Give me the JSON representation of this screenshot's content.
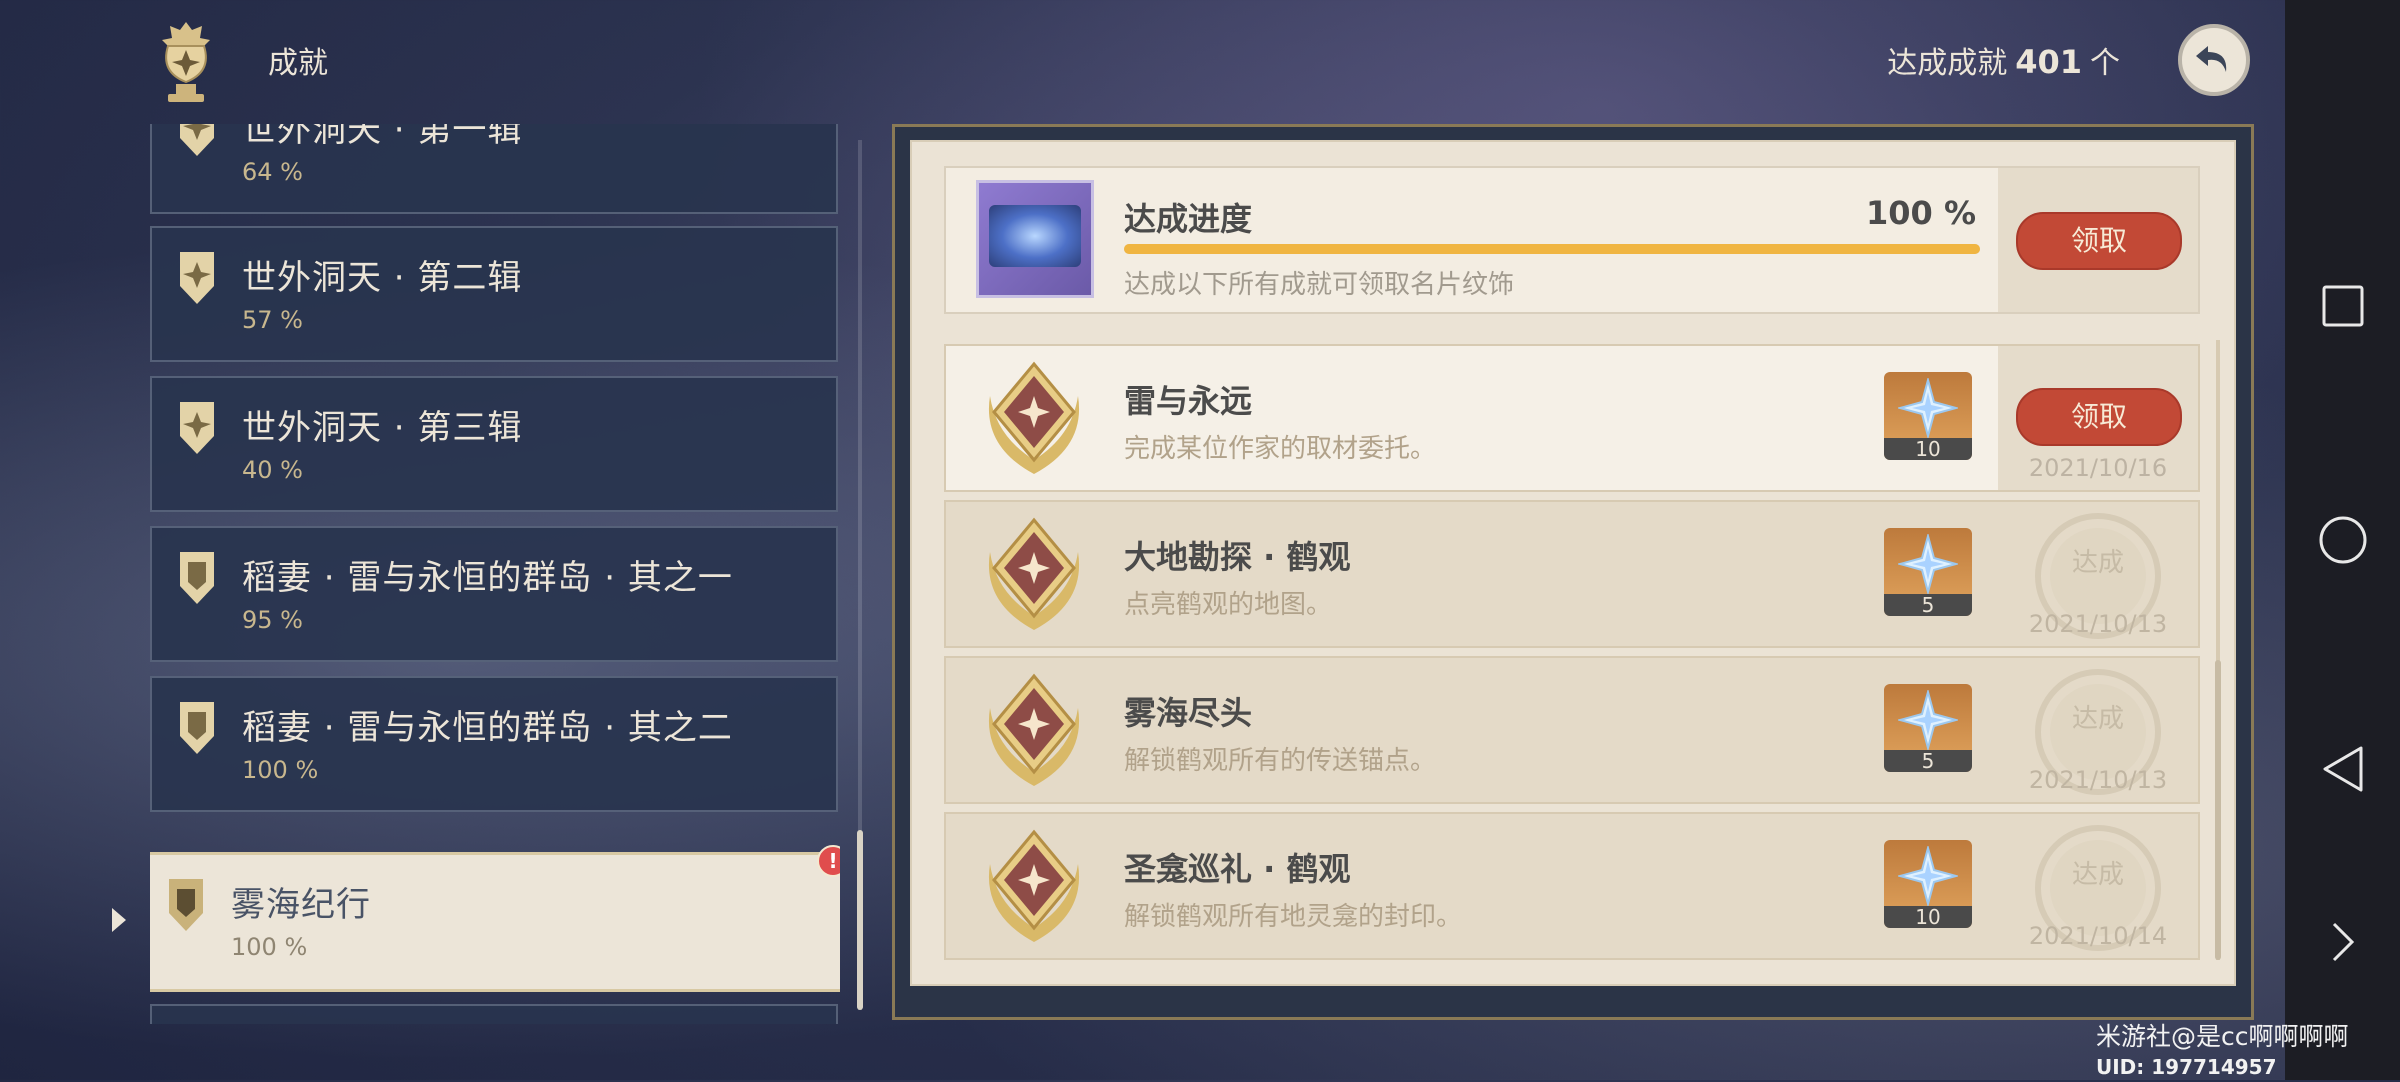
{
  "header": {
    "title": "成就",
    "total_label": "达成成就",
    "total_count": "401",
    "total_unit": "个"
  },
  "categories": [
    {
      "name": "世外洞天 · 第一辑",
      "percent": "64 %"
    },
    {
      "name": "世外洞天 · 第二辑",
      "percent": "57 %"
    },
    {
      "name": "世外洞天 · 第三辑",
      "percent": "40 %"
    },
    {
      "name": "稻妻 · 雷与永恒的群岛 · 其之一",
      "percent": "95 %"
    },
    {
      "name": "稻妻 · 雷与永恒的群岛 · 其之二",
      "percent": "100 %"
    },
    {
      "name": "雾海纪行",
      "percent": "100 %",
      "selected": true,
      "badge": "!"
    }
  ],
  "progress": {
    "title": "达成进度",
    "percent": "100 %",
    "fraction": 1.0,
    "description": "达成以下所有成就可领取名片纹饰",
    "claim_label": "领取"
  },
  "achievements": [
    {
      "title": "雷与永远",
      "description": "完成某位作家的取材委托。",
      "reward_qty": "10",
      "status": "领取",
      "date": "2021/10/16"
    },
    {
      "title": "大地勘探 · 鹤观",
      "description": "点亮鹤观的地图。",
      "reward_qty": "5",
      "status": "达成",
      "date": "2021/10/13"
    },
    {
      "title": "雾海尽头",
      "description": "解锁鹤观所有的传送锚点。",
      "reward_qty": "5",
      "status": "达成",
      "date": "2021/10/13"
    },
    {
      "title": "圣龛巡礼 · 鹤观",
      "description": "解锁鹤观所有地灵龛的封印。",
      "reward_qty": "10",
      "status": "达成",
      "date": "2021/10/14"
    }
  ],
  "watermark": {
    "line1": "米游社@是cc啊啊啊啊",
    "uid": "UID: 197714957"
  },
  "icons": {
    "trophy": "trophy-icon",
    "back": "back-arrow-icon",
    "category": "achievement-badge-icon",
    "medal": "achievement-medal-icon",
    "reward": "primogem-icon",
    "system": [
      "square-icon",
      "circle-icon",
      "triangle-back-icon",
      "chevron-right-icon"
    ]
  },
  "colors": {
    "accent_claim": "#c24936",
    "progress_fill": "#f0b541",
    "panel_paper": "#ebe3d5",
    "category_bg": "#28344e",
    "selected_bg": "#ece5d8"
  }
}
